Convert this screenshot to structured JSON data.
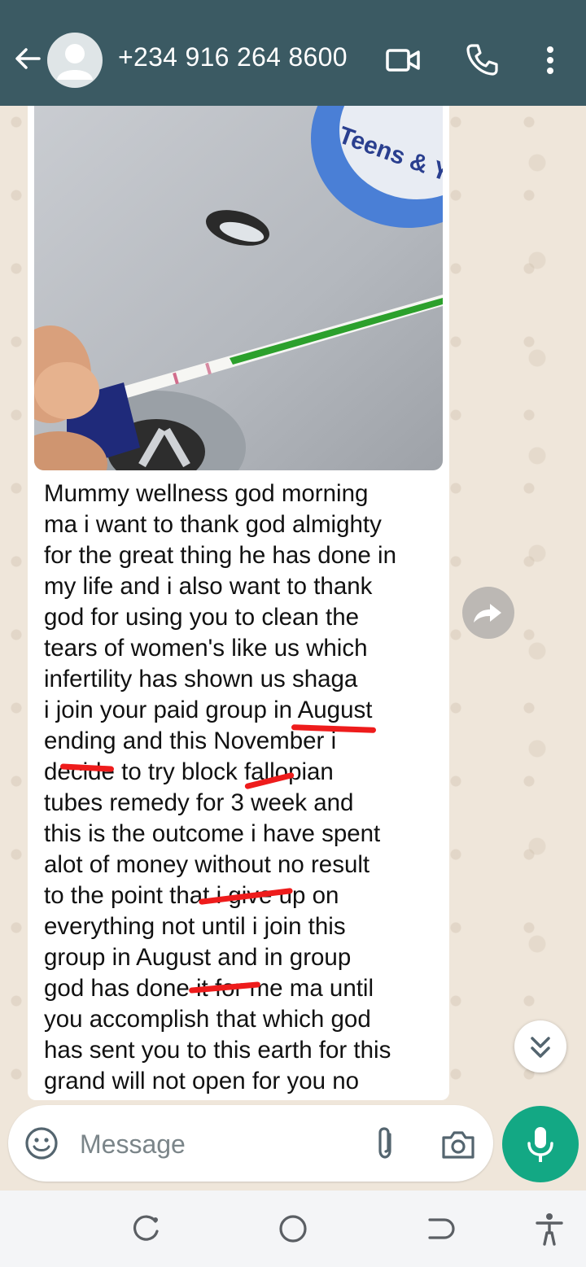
{
  "header": {
    "contact": "+234 916 264 8600",
    "bg_color": "#3b5a63"
  },
  "message": {
    "lines": [
      "Mummy wellness god morning",
      "ma i want to thank god almighty",
      "for the great thing he has done in",
      "my life and i also want to thank",
      "god for using you to clean the",
      "tears of women's like us which",
      "infertility has shown us shaga",
      "i join your paid group in August",
      "ending and this November i",
      "decide to try block fallopian",
      "tubes remedy for 3 week and",
      "this is the outcome i have spent",
      "alot of money without no result",
      "to the point that i give up on",
      "everything not until i join this",
      "group in August and in group",
      "god has done it for me ma until",
      "you accomplish that which god",
      "has sent you to this earth for this",
      "grand will not open for you no"
    ],
    "photo_label": "Teens & Youth",
    "annotation_color": "#ee1c1c"
  },
  "composer": {
    "placeholder": "Message",
    "accent_color": "#13a884"
  },
  "icons": {
    "back": "arrow-left-icon",
    "video": "video-camera-icon",
    "call": "phone-icon",
    "menu": "more-vert-icon",
    "forward": "forward-icon",
    "scroll": "double-chevron-down-icon",
    "emoji": "emoji-icon",
    "attach": "paperclip-icon",
    "camera": "camera-icon",
    "mic": "microphone-icon"
  }
}
